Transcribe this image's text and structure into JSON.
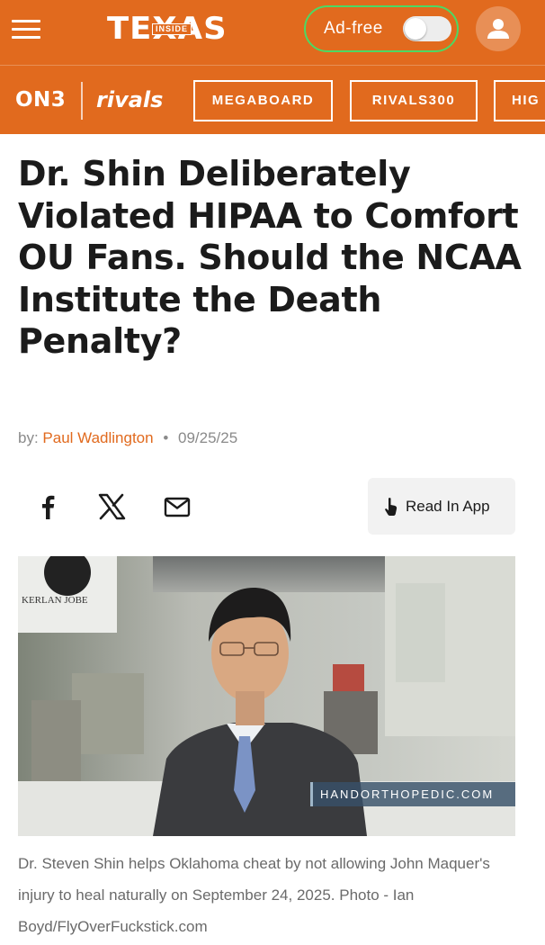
{
  "header": {
    "logo_main": "TEXAS",
    "logo_badge": "INSIDE",
    "adfree_label": "Ad-free",
    "adfree_enabled": false
  },
  "subnav": {
    "on3_label": "ON3",
    "rivals_label": "rivals",
    "buttons": [
      {
        "label": "MEGABOARD"
      },
      {
        "label": "RIVALS300"
      },
      {
        "label": "HIG"
      }
    ]
  },
  "article": {
    "headline": "Dr. Shin Deliberately Violated HIPAA to Comfort OU Fans. Should the NCAA Institute the Death Penalty?",
    "byline_prefix": "by:",
    "author": "Paul Wadlington",
    "separator": "•",
    "date": "09/25/25",
    "read_in_app_label": "Read In App",
    "photo_watermark": "HANDORTHOPEDIC.COM",
    "caption": "Dr. Steven Shin helps Oklahoma cheat by not allowing John Maquer's injury to heal naturally on September 24, 2025. Photo - Ian Boyd/FlyOverFuckstick.com",
    "photo_sign_text": "KERLAN JOBE"
  },
  "icons": {
    "menu": "hamburger-icon",
    "account": "user-icon",
    "facebook": "facebook-icon",
    "x": "x-icon",
    "email": "mail-icon",
    "tap": "tap-hand-icon"
  },
  "colors": {
    "brand_orange": "#e16a1e",
    "toggle_outline": "#4cd964",
    "author_link": "#e16a1e"
  }
}
